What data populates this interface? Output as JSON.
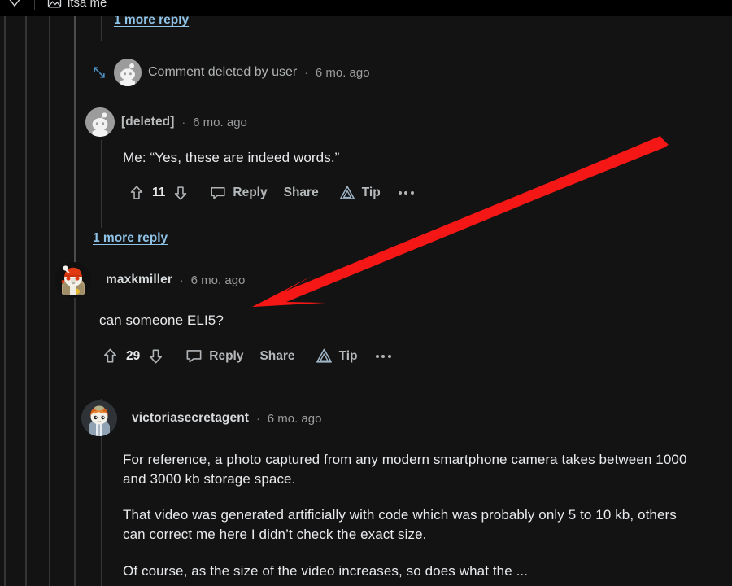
{
  "top_bar": {
    "tab_title": "itsa me",
    "image_icon": "image-icon",
    "chevron_icon": "chevron-down-icon"
  },
  "thread": {
    "top_more_reply": {
      "label": "1 more reply",
      "name": "more-replies-link-top"
    },
    "comments": [
      {
        "id": "collapsed-deleted",
        "type": "collapsed",
        "label": "Comment deleted by user",
        "separator": "·",
        "timestamp": "6 mo. ago",
        "expand_icon": "expand-icon",
        "avatar": "deleted-user-avatar"
      },
      {
        "id": "deleted-author",
        "type": "comment",
        "author": "[deleted]",
        "separator": "·",
        "timestamp": "6 mo. ago",
        "avatar": "deleted-user-avatar",
        "body": [
          "Me: “Yes, these are indeed words.”"
        ],
        "actions": {
          "upvote_icon": "upvote-arrow-icon",
          "score": "11",
          "downvote_icon": "downvote-arrow-icon",
          "comment_icon": "comment-bubble-icon",
          "reply_label": "Reply",
          "share_label": "Share",
          "tip_icon": "tip-triangle-icon",
          "tip_label": "Tip",
          "overflow_icon": "more-options-icon"
        }
      },
      {
        "id": "more-reply-mid",
        "type": "more-replies",
        "label": "1 more reply"
      },
      {
        "id": "maxkmiller",
        "type": "comment",
        "author": "maxkmiller",
        "separator": "·",
        "timestamp": "6 mo. ago",
        "avatar": "maxkmiller-avatar",
        "body": [
          "can someone ELI5?"
        ],
        "actions": {
          "upvote_icon": "upvote-arrow-icon",
          "score": "29",
          "downvote_icon": "downvote-arrow-icon",
          "comment_icon": "comment-bubble-icon",
          "reply_label": "Reply",
          "share_label": "Share",
          "tip_icon": "tip-triangle-icon",
          "tip_label": "Tip",
          "overflow_icon": "more-options-icon"
        }
      },
      {
        "id": "victoriasecretagent",
        "type": "comment",
        "author": "victoriasecretagent",
        "separator": "·",
        "timestamp": "6 mo. ago",
        "avatar": "victoriasecretagent-avatar",
        "body": [
          "For reference, a photo captured from any modern smartphone camera takes between 1000 and 3000 kb storage space.",
          "That video was generated artificially with code which was probably only 5 to 10 kb, others can correct me here I didn’t check the exact size.",
          "Of course, as the size of the video increases, so does what the ..."
        ]
      }
    ]
  },
  "annotation": {
    "shape": "red-arrow",
    "color": "#f51616",
    "points_from": "top-right",
    "points_to": "maxkmiller-comment"
  },
  "colors": {
    "page_background": "#131313",
    "header_background": "#000000",
    "body_text": "#e8eaed",
    "muted_text": "#9a9c9e",
    "link_blue": "#8fc3e8",
    "thread_line": "#343536",
    "annotation_red": "#f51616"
  }
}
